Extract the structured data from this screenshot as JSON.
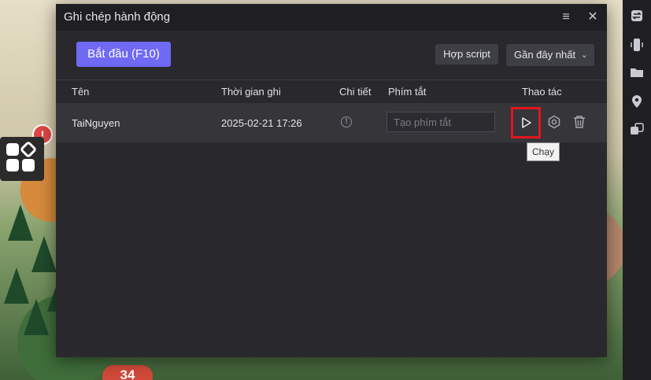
{
  "dialog": {
    "title": "Ghi chép hành động",
    "menu_icon": "menu-icon",
    "close_icon": "close-icon"
  },
  "toolbar": {
    "start_label": "Bắt đầu (F10)",
    "merge_label": "Hợp script",
    "sort_value": "Gần đây nhất"
  },
  "table": {
    "headers": {
      "name": "Tên",
      "time": "Thời gian ghi",
      "detail": "Chi tiết",
      "shortcut": "Phím tắt",
      "actions": "Thao tác"
    },
    "rows": [
      {
        "name": "TaiNguyen",
        "time": "2025-02-21 17:26",
        "detail_icon": "info-icon",
        "shortcut_placeholder": "Tạo phím tắt",
        "shortcut_value": ""
      }
    ]
  },
  "tooltip": {
    "text": "Chạy"
  },
  "background": {
    "badge_number": "34",
    "alert_mark": "!"
  },
  "colors": {
    "accent": "#6f69f4",
    "highlight_border": "#e3161d",
    "dialog_bg": "#29292d"
  }
}
